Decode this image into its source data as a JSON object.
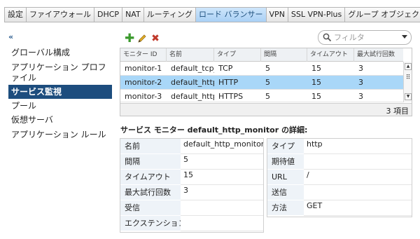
{
  "tabs": [
    "設定",
    "ファイアウォール",
    "DHCP",
    "NAT",
    "ルーティング",
    "ロード バランサー",
    "VPN",
    "SSL VPN-Plus",
    "グループ オブジェクト"
  ],
  "active_tab_index": 5,
  "sidebar": {
    "collapse_label": "«",
    "items": [
      "グローバル構成",
      "アプリケーション プロファイル",
      "サービス監視",
      "プール",
      "仮想サーバ",
      "アプリケーション ルール"
    ],
    "active_index": 2
  },
  "search": {
    "placeholder": "フィルタ"
  },
  "grid": {
    "columns": [
      "モニター ID",
      "名前",
      "タイプ",
      "間隔",
      "タイムアウト",
      "最大試行回数"
    ],
    "rows": [
      [
        "monitor-1",
        "default_tcp_monitor",
        "TCP",
        "5",
        "15",
        "3"
      ],
      [
        "monitor-2",
        "default_http_monitor",
        "HTTP",
        "5",
        "15",
        "3"
      ],
      [
        "monitor-3",
        "default_https_monitor",
        "HTTPS",
        "5",
        "15",
        "3"
      ]
    ],
    "selected_index": 1,
    "count_label": "3 項目"
  },
  "detail": {
    "title": "サービス モニター default_http_monitor の詳細:",
    "left": [
      {
        "label": "名前",
        "value": "default_http_monitor"
      },
      {
        "label": "間隔",
        "value": "5"
      },
      {
        "label": "タイムアウト",
        "value": "15"
      },
      {
        "label": "最大試行回数",
        "value": "3"
      },
      {
        "label": "受信",
        "value": ""
      },
      {
        "label": "エクステンション",
        "value": ""
      }
    ],
    "right": [
      {
        "label": "タイプ",
        "value": "http"
      },
      {
        "label": "期待値",
        "value": ""
      },
      {
        "label": "URL",
        "value": "/"
      },
      {
        "label": "送信",
        "value": ""
      },
      {
        "label": "方法",
        "value": "GET"
      }
    ]
  },
  "colors": {
    "accent": "#1d4d7e",
    "selected_row": "#a9d7f8",
    "active_tab": "#a9d0f5",
    "add_icon": "#3c9a2e",
    "delete_icon": "#c0392b",
    "edit_icon": "#d9a21a"
  }
}
